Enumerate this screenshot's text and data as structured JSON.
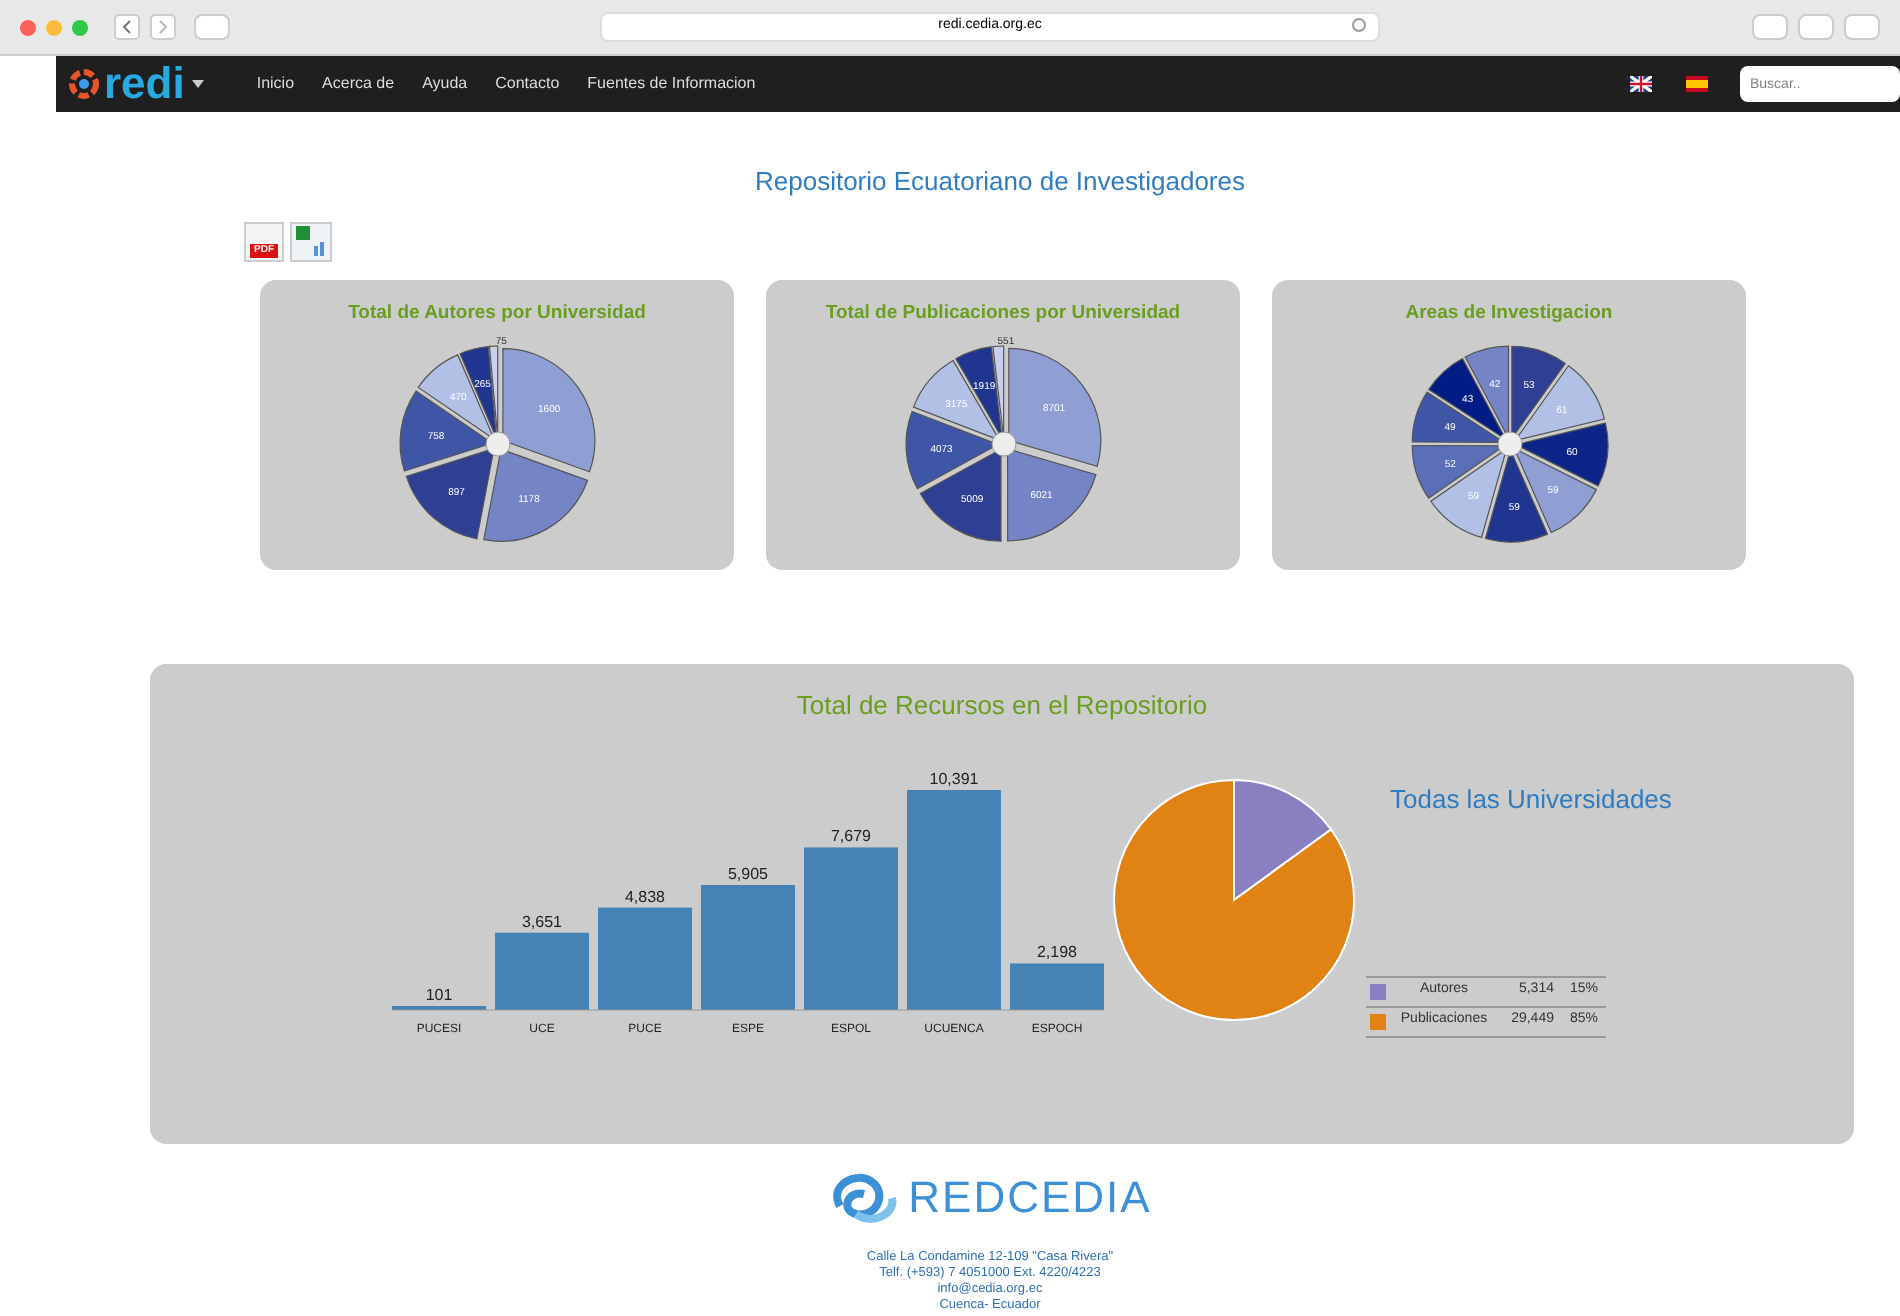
{
  "browser": {
    "url": "redi.cedia.org.ec"
  },
  "navbar": {
    "logo": "redi",
    "links": [
      "Inicio",
      "Acerca de",
      "Ayuda",
      "Contacto",
      "Fuentes de Informacion"
    ],
    "search": {
      "placeholder": "Buscar.."
    }
  },
  "title": "Repositorio Ecuatoriano de Investigadores",
  "export": {
    "pdf_label": "PDF"
  },
  "cards": [
    {
      "title": "Total de Autores por Universidad",
      "chart_data": {
        "type": "pie",
        "values": [
          1600,
          1178,
          897,
          758,
          470,
          265,
          75
        ],
        "data_labels": true
      }
    },
    {
      "title": "Total de Publicaciones por Universidad",
      "chart_data": {
        "type": "pie",
        "values": [
          8701,
          6021,
          5009,
          4073,
          3175,
          1919,
          551
        ],
        "data_labels": true
      }
    },
    {
      "title": "Areas de Investigacion",
      "chart_data": {
        "type": "pie",
        "values": [
          53,
          61,
          60,
          59,
          59,
          59,
          52,
          49,
          43,
          42
        ],
        "data_labels": true
      }
    }
  ],
  "resources": {
    "title": "Total de Recursos en el Repositorio",
    "chart_data": {
      "type": "bar",
      "categories": [
        "PUCESI",
        "UCE",
        "PUCE",
        "ESPE",
        "ESPOL",
        "UCUENCA",
        "ESPOCH"
      ],
      "values": [
        101,
        3651,
        4838,
        5905,
        7679,
        10391,
        2198
      ],
      "value_labels": [
        "101",
        "3,651",
        "4,838",
        "5,905",
        "7,679",
        "10,391",
        "2,198"
      ]
    },
    "summary": {
      "title": "Todas las Universidades",
      "chart_data": {
        "type": "pie",
        "values": [
          15,
          85
        ]
      }
    },
    "legend": [
      {
        "label": "Autores",
        "value": "5,314",
        "percent": "15%",
        "color": "#8a7fc0"
      },
      {
        "label": "Publicaciones",
        "value": "29,449",
        "percent": "85%",
        "color": "#e08214"
      }
    ]
  },
  "footer": {
    "logo": "REDCEDIA",
    "lines": [
      "Calle La Condamine 12-109 \"Casa Rivera\"",
      "Telf. (+593) 7 4051000 Ext. 4220/4223",
      "info@cedia.org.ec",
      "Cuenca- Ecuador"
    ]
  }
}
